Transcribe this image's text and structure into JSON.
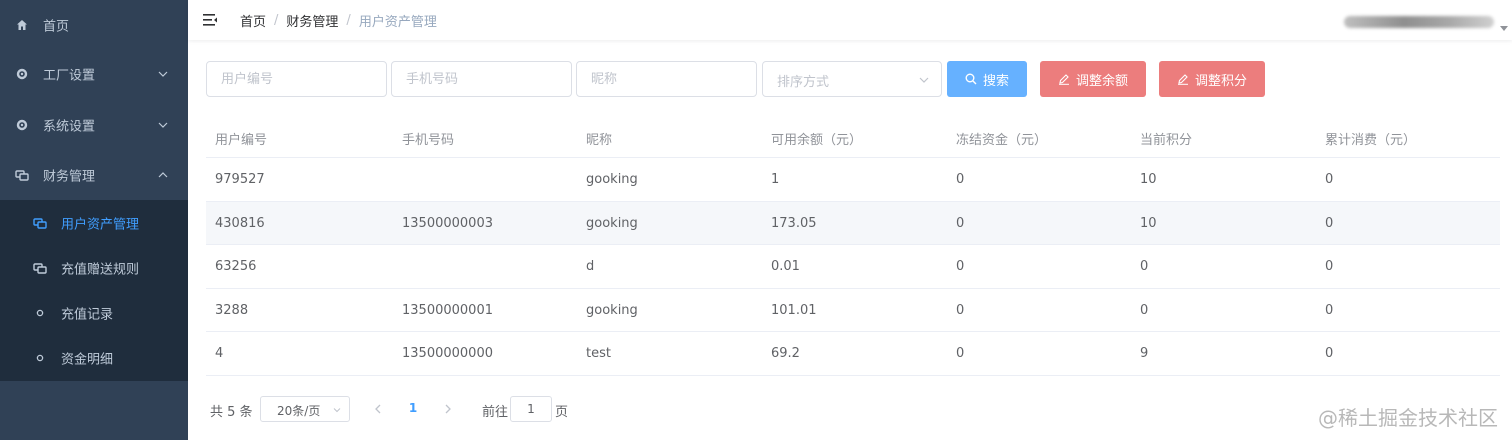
{
  "sidebar": {
    "items": [
      {
        "label": "首页",
        "icon": "home-icon"
      },
      {
        "label": "工厂设置",
        "icon": "gear-icon"
      },
      {
        "label": "系统设置",
        "icon": "gear-icon"
      },
      {
        "label": "财务管理",
        "icon": "money-icon"
      }
    ],
    "submenu": [
      {
        "label": "用户资产管理",
        "icon": "money-icon",
        "active": true
      },
      {
        "label": "充值赠送规则",
        "icon": "money-icon"
      },
      {
        "label": "充值记录",
        "icon": "dot-icon"
      },
      {
        "label": "资金明细",
        "icon": "dot-icon"
      }
    ],
    "bg_color": "#304156",
    "submenu_bg_color": "#1f2d3d",
    "active_color": "#409eff"
  },
  "header": {
    "breadcrumb": [
      "首页",
      "财务管理",
      "用户资产管理"
    ],
    "separator": "/"
  },
  "filters": {
    "user_id_placeholder": "用户编号",
    "phone_placeholder": "手机号码",
    "nickname_placeholder": "昵称",
    "sort_placeholder": "排序方式",
    "search_label": "搜索",
    "adjust_balance_label": "调整余额",
    "adjust_points_label": "调整积分"
  },
  "table": {
    "columns": [
      "用户编号",
      "手机号码",
      "昵称",
      "可用余额（元）",
      "冻结资金（元）",
      "当前积分",
      "累计消费（元）"
    ],
    "rows": [
      [
        "979527",
        "",
        "gooking",
        "1",
        "0",
        "10",
        "0"
      ],
      [
        "430816",
        "13500000003",
        "gooking",
        "173.05",
        "0",
        "10",
        "0"
      ],
      [
        "63256",
        "",
        "d",
        "0.01",
        "0",
        "0",
        "0"
      ],
      [
        "3288",
        "13500000001",
        "gooking",
        "101.01",
        "0",
        "0",
        "0"
      ],
      [
        "4",
        "13500000000",
        "test",
        "69.2",
        "0",
        "9",
        "0"
      ]
    ]
  },
  "pagination": {
    "total_text": "共 5 条",
    "page_size": "20条/页",
    "current_page": "1",
    "goto_label": "前往",
    "goto_value": "1",
    "page_unit": "页"
  },
  "watermark": "@稀土掘金技术社区",
  "colors": {
    "primary": "#409eff",
    "search_button": "#66b1ff",
    "danger_button": "#ec7d7d"
  }
}
